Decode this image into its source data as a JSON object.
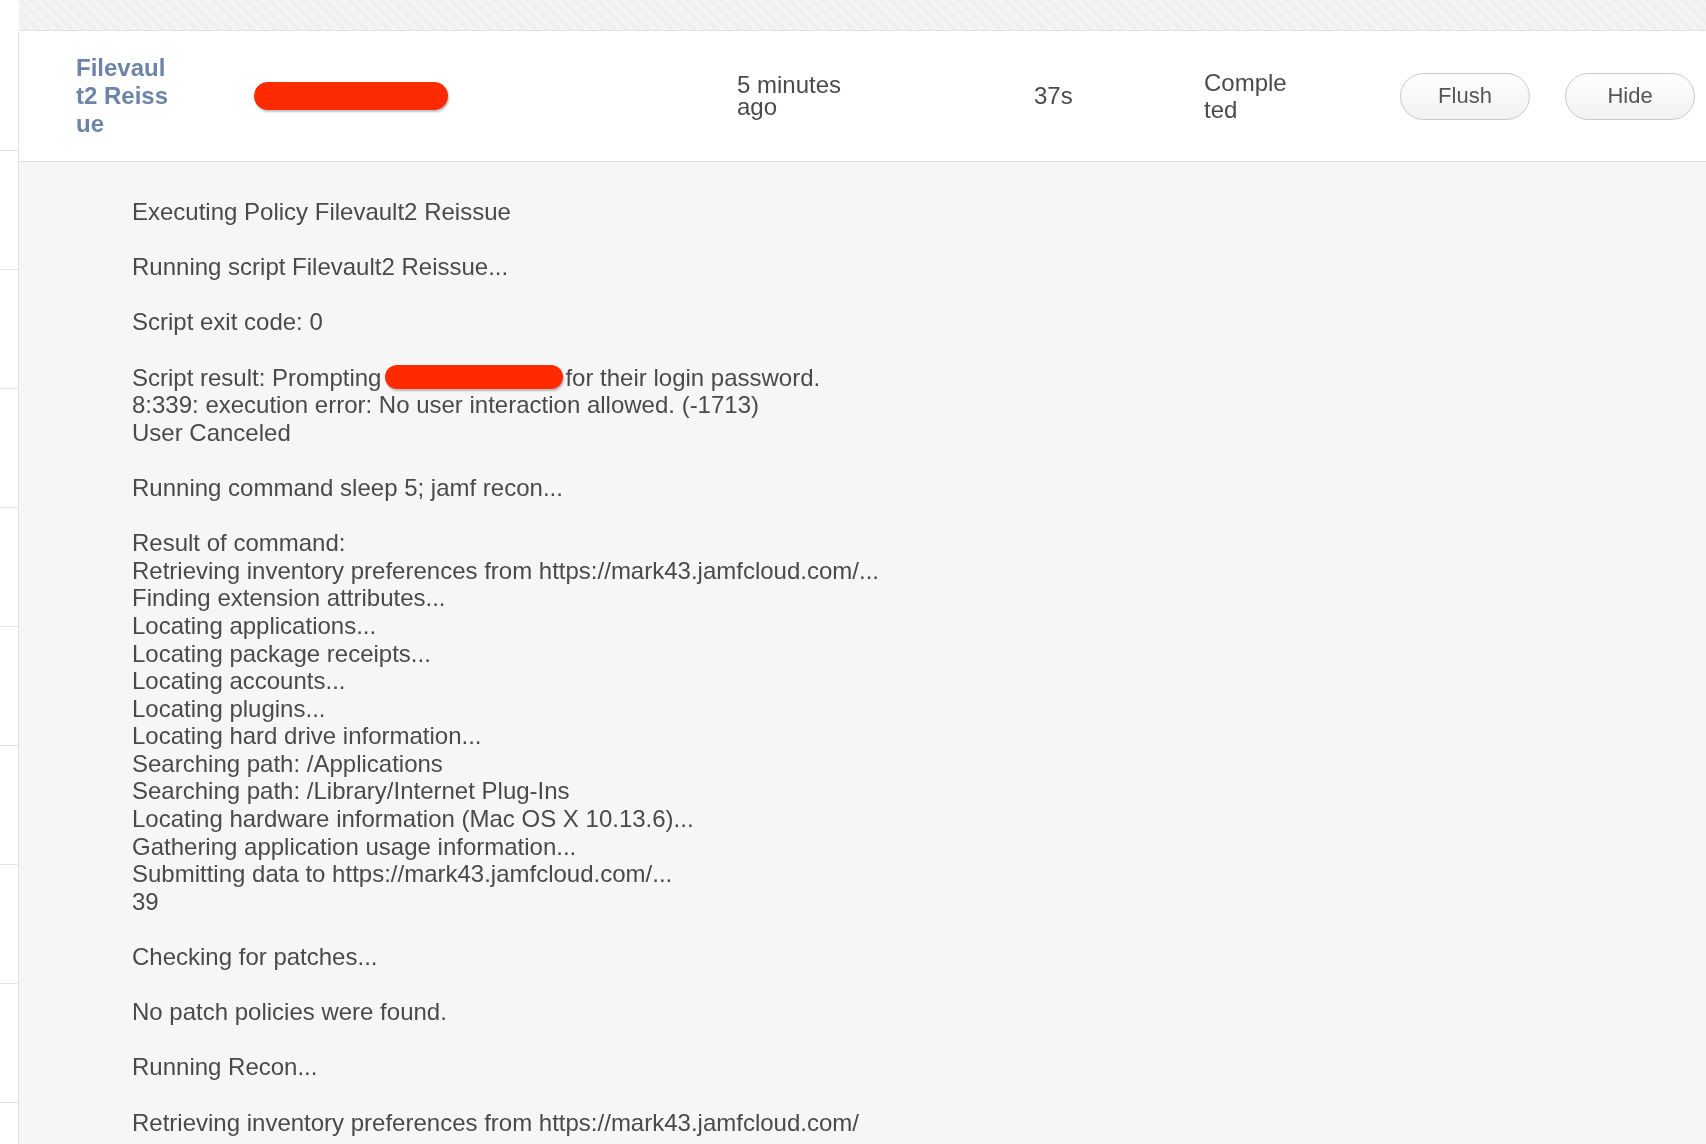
{
  "row": {
    "policy_name": "Filevault2 Reissue",
    "time": "5 minutes ago",
    "duration": "37s",
    "status": "Completed",
    "buttons": [
      "Flush",
      "Hide"
    ]
  },
  "log": {
    "blocks": [
      [
        {
          "kind": "text",
          "text": "Executing Policy Filevault2 Reissue"
        }
      ],
      [
        {
          "kind": "text",
          "text": "Running script Filevault2 Reissue..."
        }
      ],
      [
        {
          "kind": "text",
          "text": "Script exit code: 0"
        }
      ],
      [
        {
          "kind": "redacted",
          "before": "Script result: Prompting",
          "after": "for their login password."
        },
        {
          "kind": "text",
          "text": "8:339: execution error: No user interaction allowed. (-1713)"
        },
        {
          "kind": "text",
          "text": "User Canceled"
        }
      ],
      [
        {
          "kind": "text",
          "text": "Running command sleep 5; jamf recon..."
        }
      ],
      [
        {
          "kind": "text",
          "text": "Result of command:"
        },
        {
          "kind": "text",
          "text": "Retrieving inventory preferences from https://mark43.jamfcloud.com/..."
        },
        {
          "kind": "text",
          "text": "Finding extension attributes..."
        },
        {
          "kind": "text",
          "text": "Locating applications..."
        },
        {
          "kind": "text",
          "text": "Locating package receipts..."
        },
        {
          "kind": "text",
          "text": "Locating accounts..."
        },
        {
          "kind": "text",
          "text": "Locating plugins..."
        },
        {
          "kind": "text",
          "text": "Locating hard drive information..."
        },
        {
          "kind": "text",
          "text": "Searching path: /Applications"
        },
        {
          "kind": "text",
          "text": "Searching path: /Library/Internet Plug-Ins"
        },
        {
          "kind": "text",
          "text": "Locating hardware information (Mac OS X 10.13.6)..."
        },
        {
          "kind": "text",
          "text": "Gathering application usage information..."
        },
        {
          "kind": "text",
          "text": "Submitting data to https://mark43.jamfcloud.com/..."
        },
        {
          "kind": "text",
          "text": "39"
        }
      ],
      [
        {
          "kind": "text",
          "text": "Checking for patches..."
        }
      ],
      [
        {
          "kind": "text",
          "text": "No patch policies were found."
        }
      ],
      [
        {
          "kind": "text",
          "text": "Running Recon..."
        }
      ],
      [
        {
          "kind": "text",
          "text": "Retrieving inventory preferences from https://mark43.jamfcloud.com/"
        }
      ]
    ]
  }
}
